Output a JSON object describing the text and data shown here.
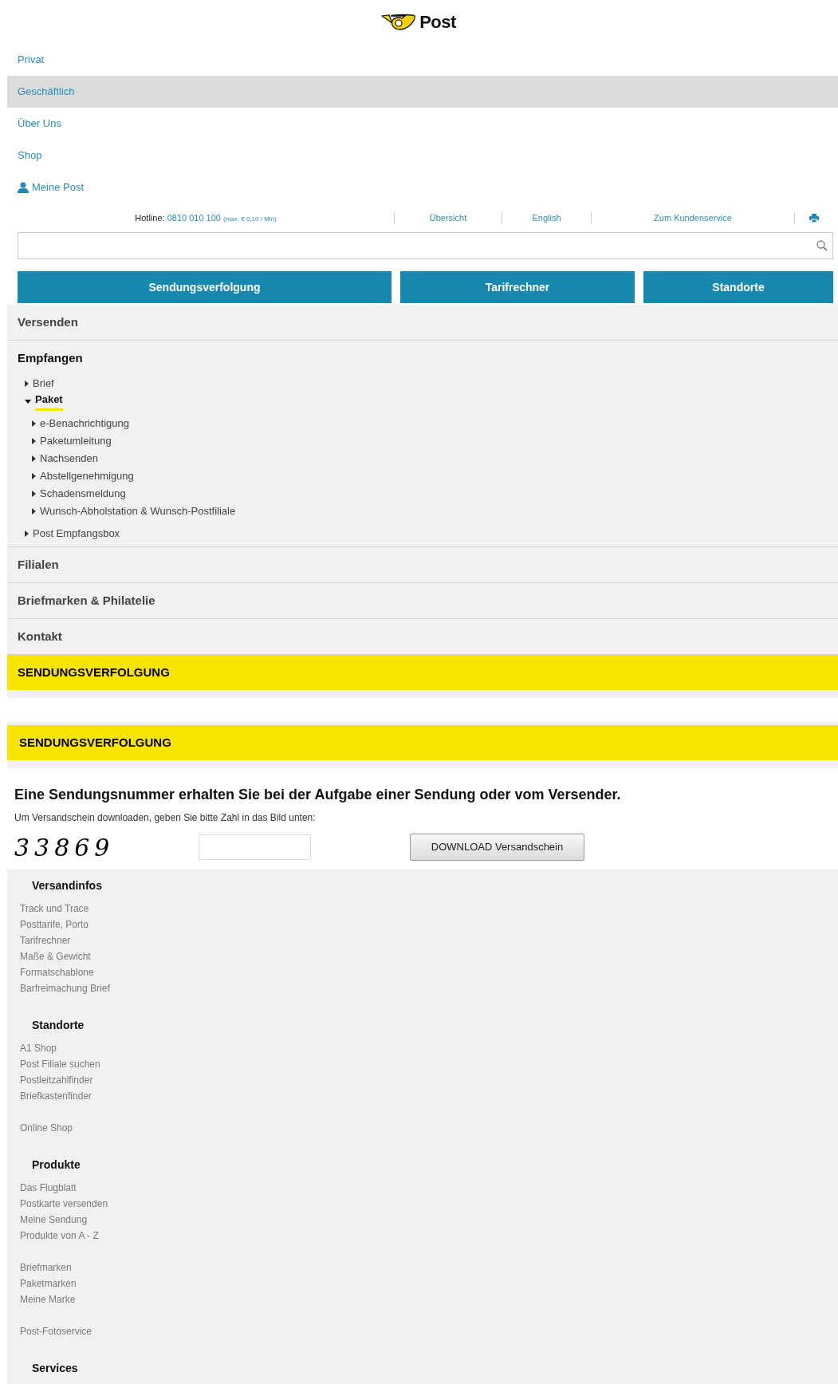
{
  "logo": {
    "text": "Post"
  },
  "main_nav": [
    {
      "label": "Privat",
      "selected": false,
      "kind": "link"
    },
    {
      "label": "Geschäftlich",
      "selected": true,
      "kind": "link"
    },
    {
      "label": "Über Uns",
      "selected": false,
      "kind": "link"
    },
    {
      "label": "Shop",
      "selected": false,
      "kind": "link"
    },
    {
      "label": "Meine Post",
      "selected": false,
      "kind": "user"
    }
  ],
  "utility_bar": {
    "hotline_label": "Hotline:",
    "hotline_number": "0810 010 100",
    "hotline_note": "(max. € 0,10 / Min)",
    "links": [
      "Übersicht",
      "English",
      "Zum Kundenservice"
    ]
  },
  "quick_buttons": [
    "Sendungsverfolgung",
    "Tarifrechner",
    "Standorte"
  ],
  "accordion": [
    {
      "label": "Versenden",
      "expanded": false
    },
    {
      "label": "Empfangen",
      "expanded": true,
      "children": [
        {
          "label": "Brief",
          "expanded": false,
          "selected": false
        },
        {
          "label": "Paket",
          "expanded": true,
          "selected": true,
          "children": [
            {
              "label": "e-Benachrichtigung",
              "selected": false
            },
            {
              "label": "Paketumleitung",
              "selected": false
            },
            {
              "label": "Nachsenden",
              "selected": false
            },
            {
              "label": "Abstellgenehmigung",
              "selected": false
            },
            {
              "label": "Schadensmeldung",
              "selected": false
            },
            {
              "label": "Wunsch-Abholstation & Wunsch-Postfiliale",
              "selected": false
            }
          ]
        },
        {
          "label": "Post Empfangsbox",
          "expanded": false,
          "selected": false
        }
      ]
    },
    {
      "label": "Filialen",
      "expanded": false
    },
    {
      "label": "Briefmarken & Philatelie",
      "expanded": false
    },
    {
      "label": "Kontakt",
      "expanded": false
    }
  ],
  "active_section": "SENDUNGSVERFOLGUNG",
  "tracking": {
    "title": "SENDUNGSVERFOLGUNG",
    "heading": "Eine Sendungsnummer erhalten Sie bei der Aufgabe einer Sendung oder vom Versender.",
    "instruction": "Um Versandschein downloaden, geben Sie bitte Zahl in das Bild unten:",
    "captcha": "33869",
    "download_button": "DOWNLOAD Versandschein"
  },
  "footer": [
    {
      "heading": "Versandinfos",
      "link_groups": [
        [
          "Track und Trace",
          "Posttarife, Porto",
          "Tarifrechner",
          "Maße & Gewicht",
          "Formatschablone",
          "Barfreimachung Brief"
        ]
      ]
    },
    {
      "heading": "Standorte",
      "link_groups": [
        [
          "A1 Shop",
          "Post Filiale suchen",
          "Postleitzahlfinder",
          "Briefkastenfinder"
        ],
        [
          "Online Shop"
        ]
      ]
    },
    {
      "heading": "Produkte",
      "link_groups": [
        [
          "Das Flugblatt",
          "Postkarte versenden",
          "Meine Sendung",
          "Produkte von A - Z"
        ],
        [
          "Briefmarken",
          "Paketmarken",
          "Meine Marke"
        ],
        [
          "Post-Fotoservice"
        ]
      ]
    },
    {
      "heading": "Services"
    }
  ]
}
